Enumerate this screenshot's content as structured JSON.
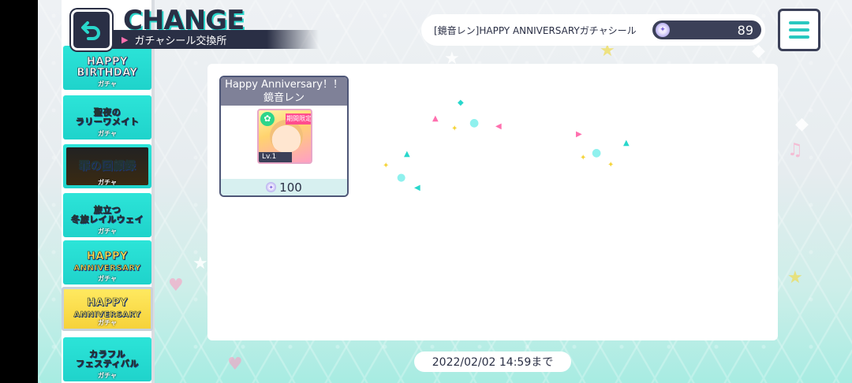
{
  "header": {
    "title": "CHANGE",
    "subtitle": "ガチャシール交換所",
    "back_icon": "back-arrow-icon",
    "menu_icon": "hamburger-menu-icon"
  },
  "currency": {
    "label": "[鏡音レン]HAPPY ANNIVERSARYガチャシール",
    "count": "89",
    "icon": "gacha-sticker-coin-icon"
  },
  "gacha_list": [
    {
      "line1": "HAPPY",
      "line2": "BIRTHDAY",
      "tag": "ガチャ"
    },
    {
      "line1": "聖夜の",
      "line2": "ラリーワメイト",
      "tag": "ガチャ"
    },
    {
      "line1": "罪の",
      "line2": "回顧録",
      "tag": "ガチャ"
    },
    {
      "line1": "旅立つ",
      "line2": "冬旅レイルウェイ",
      "tag": "ガチャ"
    },
    {
      "line1": "HAPPY",
      "line2": "ANNIVERSARY",
      "tag": "ガチャ"
    },
    {
      "line1": "HAPPY",
      "line2": "ANNIVERSARY",
      "tag": "ガチャ"
    },
    {
      "line1": "カラフル",
      "line2": "フェスティバル",
      "tag": "ガチャ"
    }
  ],
  "item": {
    "title_line1": "Happy Anniversary！！",
    "title_line2": "鏡音レン",
    "limited_label": "期間限定",
    "level": "Lv.1",
    "price": "100"
  },
  "deadline": "2022/02/02 14:59まで",
  "colors": {
    "accent": "#29c8c0",
    "navy": "#2a2f45",
    "card_header": "#7f8198"
  }
}
